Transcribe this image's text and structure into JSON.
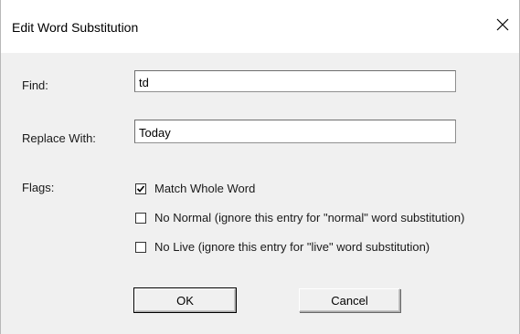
{
  "dialog": {
    "title": "Edit Word Substitution",
    "close_icon": "close-icon"
  },
  "fields": {
    "find_label": "Find:",
    "find_value": "td",
    "replace_label": "Replace With:",
    "replace_value": "Today"
  },
  "flags": {
    "label": "Flags:",
    "items": [
      {
        "label": "Match Whole Word",
        "checked": true
      },
      {
        "label": "No Normal (ignore this entry for \"normal\" word substitution)",
        "checked": false
      },
      {
        "label": "No Live (ignore this entry for \"live\" word substitution)",
        "checked": false
      }
    ]
  },
  "buttons": {
    "ok": "OK",
    "cancel": "Cancel"
  }
}
